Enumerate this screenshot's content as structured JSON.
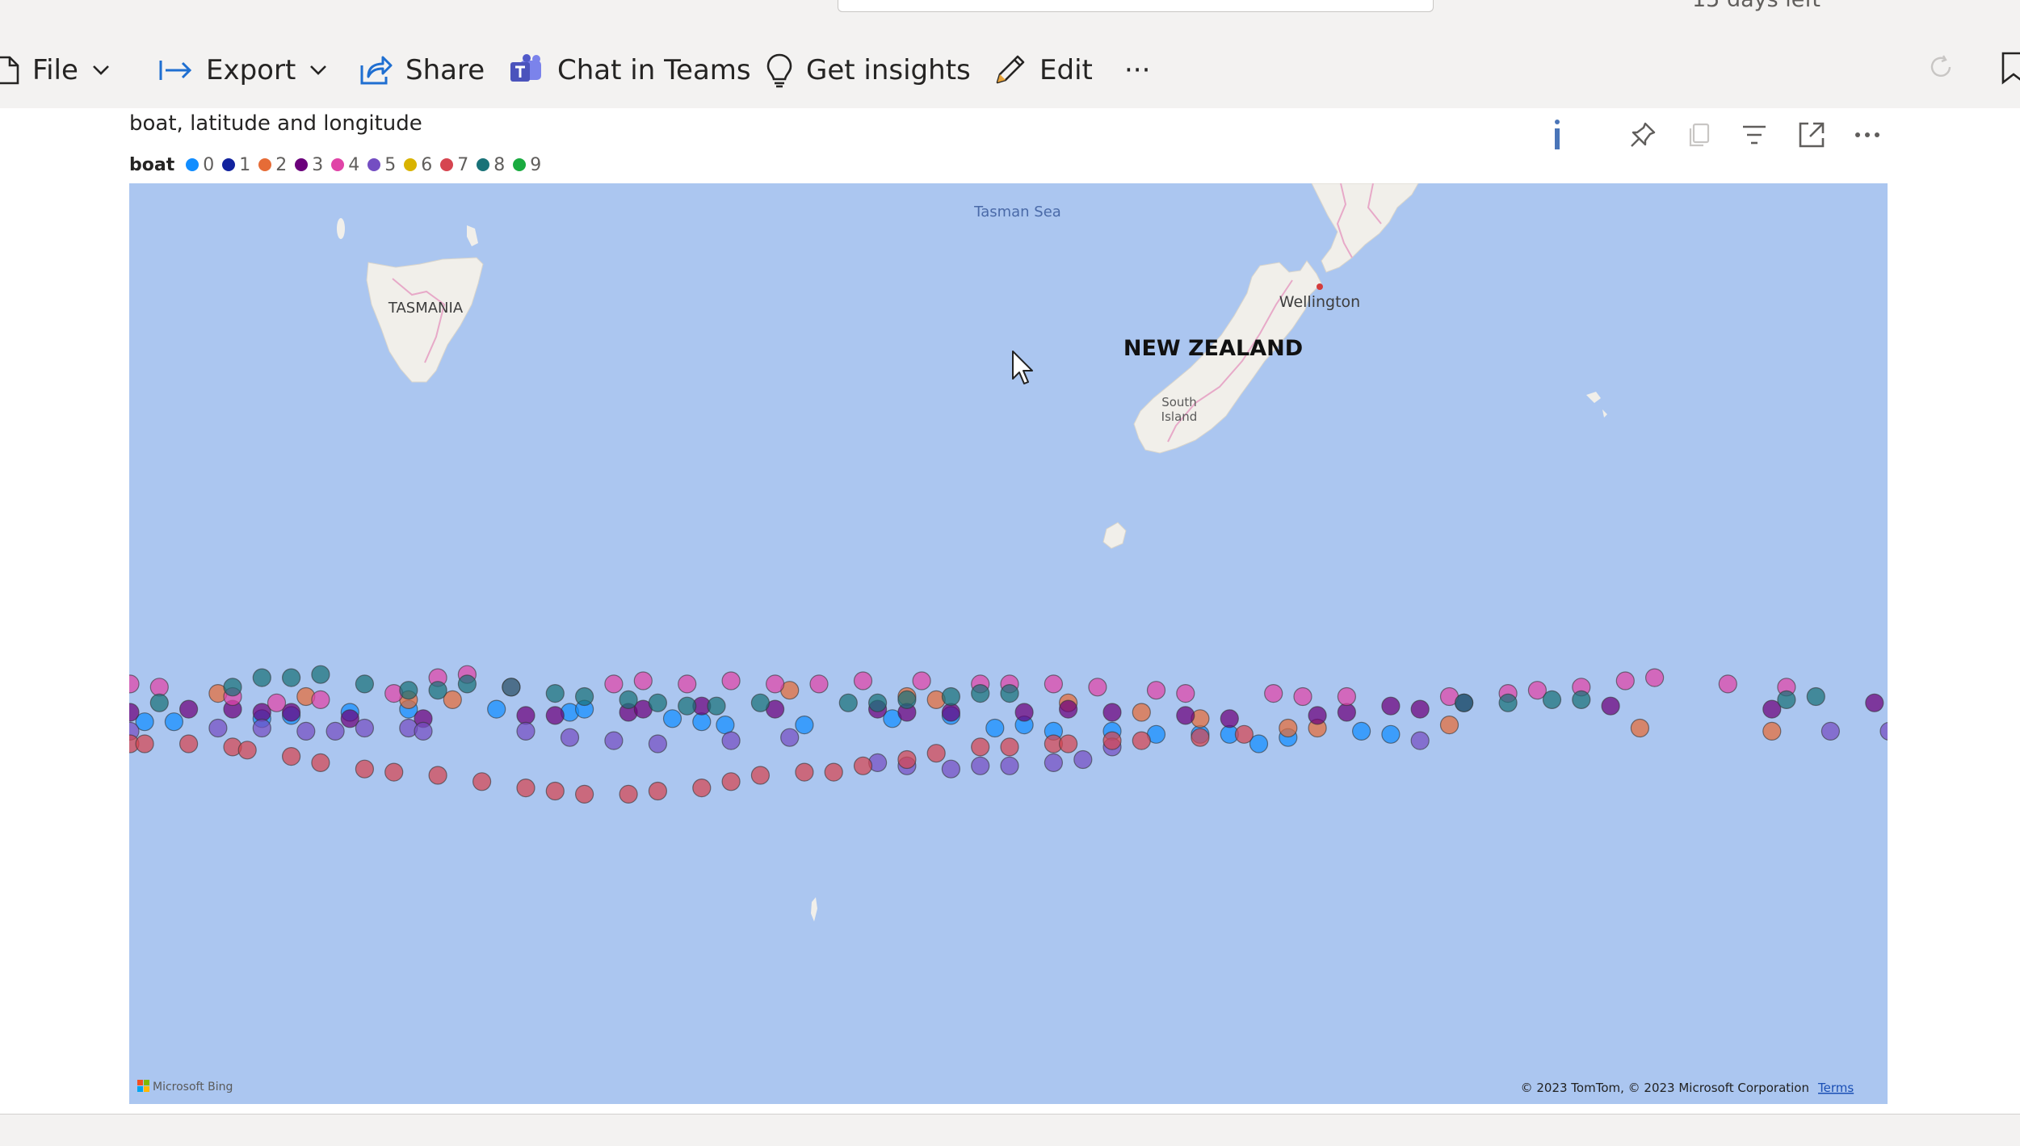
{
  "header": {
    "trial_text": "15 days left"
  },
  "toolbar": {
    "file_label": "File",
    "export_label": "Export",
    "share_label": "Share",
    "chat_label": "Chat in Teams",
    "insights_label": "Get insights",
    "edit_label": "Edit",
    "more_label": "···"
  },
  "visual": {
    "title": "boat, latitude and longitude",
    "legend_title": "boat",
    "legend": [
      {
        "label": "0",
        "color": "#118dff"
      },
      {
        "label": "1",
        "color": "#12239e"
      },
      {
        "label": "2",
        "color": "#e66c37"
      },
      {
        "label": "3",
        "color": "#6b007b"
      },
      {
        "label": "4",
        "color": "#e044a7"
      },
      {
        "label": "5",
        "color": "#744ec2"
      },
      {
        "label": "6",
        "color": "#d9b300"
      },
      {
        "label": "7",
        "color": "#d64550"
      },
      {
        "label": "8",
        "color": "#197278"
      },
      {
        "label": "9",
        "color": "#1aab40"
      }
    ],
    "header_icons": [
      "info-icon",
      "pin-icon",
      "copy-icon",
      "filter-icon",
      "focus-mode-icon",
      "more-options-icon"
    ]
  },
  "map": {
    "labels": {
      "sea": "Tasman Sea",
      "tasmania": "TASMANIA",
      "country": "NEW ZEALAND",
      "city": "Wellington",
      "island": "South\nIsland"
    },
    "attribution": "© 2023 TomTom, © 2023 Microsoft Corporation",
    "terms": "Terms",
    "provider": "Microsoft Bing",
    "water_color": "#abc6f0",
    "land_color": "#f1efea"
  },
  "chart_data": {
    "type": "scatter",
    "title": "boat, latitude and longitude",
    "legend_title": "boat",
    "legend_placement": "top-left",
    "series": [
      {
        "name": "0",
        "points": [
          [
            167.5,
            -55.7
          ],
          [
            168.5,
            -55.7
          ],
          [
            171.5,
            -55.6
          ],
          [
            172.5,
            -55.5
          ],
          [
            174.5,
            -55.4
          ],
          [
            176.5,
            -55.3
          ],
          [
            179.5,
            -55.3
          ],
          [
            182.0,
            -55.4
          ],
          [
            182.5,
            -55.3
          ],
          [
            185.5,
            -55.6
          ],
          [
            186.5,
            -55.7
          ],
          [
            187.3,
            -55.8
          ],
          [
            190.0,
            -55.8
          ],
          [
            193.0,
            -55.6
          ],
          [
            195.0,
            -55.5
          ],
          [
            196.5,
            -55.9
          ],
          [
            197.5,
            -55.8
          ],
          [
            198.5,
            -56.0
          ],
          [
            200.5,
            -56.0
          ],
          [
            202.0,
            -56.1
          ],
          [
            203.5,
            -56.1
          ],
          [
            204.5,
            -56.1
          ],
          [
            205.5,
            -56.4
          ],
          [
            206.5,
            -56.2
          ],
          [
            209.0,
            -56.0
          ],
          [
            210.0,
            -56.1
          ]
        ]
      },
      {
        "name": "2",
        "points": [
          [
            170.0,
            -54.8
          ],
          [
            173.0,
            -54.9
          ],
          [
            176.5,
            -55.0
          ],
          [
            178.0,
            -55.0
          ],
          [
            189.5,
            -54.7
          ],
          [
            193.5,
            -54.9
          ],
          [
            194.5,
            -55.0
          ],
          [
            199.0,
            -55.1
          ],
          [
            201.5,
            -55.4
          ],
          [
            203.5,
            -55.6
          ],
          [
            206.5,
            -55.9
          ],
          [
            207.5,
            -55.9
          ],
          [
            212.0,
            -55.8
          ],
          [
            218.5,
            -55.9
          ],
          [
            223.0,
            -56.0
          ],
          [
            228.5,
            -55.9
          ],
          [
            229.5,
            -55.9
          ],
          [
            234.0,
            -56.2
          ],
          [
            236.0,
            -56.0
          ],
          [
            236.5,
            -55.9
          ],
          [
            239.0,
            -55.7
          ],
          [
            240.5,
            -55.5
          ],
          [
            243.0,
            -55.7
          ],
          [
            244.0,
            -55.6
          ],
          [
            248.0,
            -56.0
          ],
          [
            250.0,
            -56.2
          ],
          [
            251.0,
            -56.3
          ],
          [
            253.5,
            -56.6
          ],
          [
            255.5,
            -56.9
          ],
          [
            256.0,
            -56.9
          ]
        ]
      },
      {
        "name": "3",
        "points": [
          [
            167.0,
            -55.4
          ],
          [
            169.0,
            -55.3
          ],
          [
            170.5,
            -55.3
          ],
          [
            171.5,
            -55.4
          ],
          [
            172.5,
            -55.4
          ],
          [
            174.5,
            -55.6
          ],
          [
            177.0,
            -55.6
          ],
          [
            180.5,
            -55.5
          ],
          [
            181.5,
            -55.5
          ],
          [
            184.0,
            -55.4
          ],
          [
            184.5,
            -55.3
          ],
          [
            186.5,
            -55.2
          ],
          [
            189.0,
            -55.3
          ],
          [
            192.5,
            -55.3
          ],
          [
            193.5,
            -55.4
          ],
          [
            195.0,
            -55.4
          ],
          [
            197.5,
            -55.4
          ],
          [
            199.0,
            -55.3
          ],
          [
            200.5,
            -55.4
          ],
          [
            203.0,
            -55.5
          ],
          [
            204.5,
            -55.6
          ],
          [
            207.5,
            -55.5
          ],
          [
            208.5,
            -55.4
          ],
          [
            210.0,
            -55.2
          ],
          [
            211.0,
            -55.3
          ],
          [
            212.5,
            -55.1
          ],
          [
            217.5,
            -55.2
          ],
          [
            223.0,
            -55.3
          ],
          [
            226.5,
            -55.1
          ],
          [
            232.0,
            -55.0
          ],
          [
            233.5,
            -54.9
          ],
          [
            238.5,
            -54.7
          ]
        ]
      },
      {
        "name": "4",
        "points": [
          [
            167.0,
            -54.5
          ],
          [
            168.0,
            -54.6
          ],
          [
            170.5,
            -54.9
          ],
          [
            172.0,
            -55.1
          ],
          [
            173.5,
            -55.0
          ],
          [
            176.0,
            -54.8
          ],
          [
            177.5,
            -54.3
          ],
          [
            178.5,
            -54.2
          ],
          [
            180.0,
            -54.6
          ],
          [
            183.5,
            -54.5
          ],
          [
            184.5,
            -54.4
          ],
          [
            186.0,
            -54.5
          ],
          [
            187.5,
            -54.4
          ],
          [
            189.0,
            -54.5
          ],
          [
            190.5,
            -54.5
          ],
          [
            192.0,
            -54.4
          ],
          [
            194.0,
            -54.4
          ],
          [
            196.0,
            -54.5
          ],
          [
            197.0,
            -54.5
          ],
          [
            198.5,
            -54.5
          ],
          [
            200.0,
            -54.6
          ],
          [
            202.0,
            -54.7
          ],
          [
            203.0,
            -54.8
          ],
          [
            206.0,
            -54.8
          ],
          [
            207.0,
            -54.9
          ],
          [
            208.5,
            -54.9
          ],
          [
            212.0,
            -54.9
          ],
          [
            214.0,
            -54.8
          ],
          [
            215.0,
            -54.7
          ],
          [
            216.5,
            -54.6
          ],
          [
            218.0,
            -54.4
          ],
          [
            219.0,
            -54.3
          ],
          [
            221.5,
            -54.5
          ],
          [
            223.5,
            -54.6
          ]
        ]
      },
      {
        "name": "5",
        "points": [
          [
            167.0,
            -56.0
          ],
          [
            170.0,
            -55.9
          ],
          [
            171.5,
            -55.9
          ],
          [
            173.0,
            -56.0
          ],
          [
            174.0,
            -56.0
          ],
          [
            175.0,
            -55.9
          ],
          [
            176.5,
            -55.9
          ],
          [
            177.0,
            -56.0
          ],
          [
            180.5,
            -56.0
          ],
          [
            182.0,
            -56.2
          ],
          [
            183.5,
            -56.3
          ],
          [
            185.0,
            -56.4
          ],
          [
            187.5,
            -56.3
          ],
          [
            189.5,
            -56.2
          ],
          [
            192.5,
            -57.0
          ],
          [
            193.5,
            -57.1
          ],
          [
            195.0,
            -57.2
          ],
          [
            196.0,
            -57.1
          ],
          [
            197.0,
            -57.1
          ],
          [
            198.5,
            -57.0
          ],
          [
            199.5,
            -56.9
          ],
          [
            200.5,
            -56.5
          ],
          [
            211.0,
            -56.3
          ],
          [
            225.0,
            -56.0
          ],
          [
            227.0,
            -56.0
          ],
          [
            228.0,
            -56.0
          ],
          [
            229.5,
            -56.0
          ]
        ]
      },
      {
        "name": "7",
        "points": [
          [
            167.0,
            -56.4
          ],
          [
            167.5,
            -56.4
          ],
          [
            169.0,
            -56.4
          ],
          [
            170.5,
            -56.5
          ],
          [
            171.0,
            -56.6
          ],
          [
            172.5,
            -56.8
          ],
          [
            173.5,
            -57.0
          ],
          [
            175.0,
            -57.2
          ],
          [
            176.0,
            -57.3
          ],
          [
            177.5,
            -57.4
          ],
          [
            179.0,
            -57.6
          ],
          [
            180.5,
            -57.8
          ],
          [
            181.5,
            -57.9
          ],
          [
            182.5,
            -58.0
          ],
          [
            184.0,
            -58.0
          ],
          [
            185.0,
            -57.9
          ],
          [
            186.5,
            -57.8
          ],
          [
            187.5,
            -57.6
          ],
          [
            188.5,
            -57.4
          ],
          [
            190.0,
            -57.3
          ],
          [
            191.0,
            -57.3
          ],
          [
            192.0,
            -57.1
          ],
          [
            193.5,
            -56.9
          ],
          [
            194.5,
            -56.7
          ],
          [
            196.0,
            -56.5
          ],
          [
            197.0,
            -56.5
          ],
          [
            198.5,
            -56.4
          ],
          [
            199.0,
            -56.4
          ],
          [
            200.5,
            -56.3
          ],
          [
            201.5,
            -56.3
          ],
          [
            203.5,
            -56.2
          ],
          [
            205.0,
            -56.1
          ]
        ]
      },
      {
        "name": "8",
        "points": [
          [
            166.5,
            -55.2
          ],
          [
            168.0,
            -55.1
          ],
          [
            170.5,
            -54.6
          ],
          [
            171.5,
            -54.3
          ],
          [
            172.5,
            -54.3
          ],
          [
            173.5,
            -54.2
          ],
          [
            175.0,
            -54.5
          ],
          [
            176.5,
            -54.7
          ],
          [
            177.5,
            -54.7
          ],
          [
            178.5,
            -54.5
          ],
          [
            180.0,
            -54.6
          ],
          [
            181.5,
            -54.8
          ],
          [
            182.5,
            -54.9
          ],
          [
            184.0,
            -55.0
          ],
          [
            185.0,
            -55.1
          ],
          [
            186.0,
            -55.2
          ],
          [
            187.0,
            -55.2
          ],
          [
            188.5,
            -55.1
          ],
          [
            191.5,
            -55.1
          ],
          [
            192.5,
            -55.1
          ],
          [
            193.5,
            -55.0
          ],
          [
            195.0,
            -54.9
          ],
          [
            196.0,
            -54.8
          ],
          [
            197.0,
            -54.8
          ],
          [
            212.5,
            -55.1
          ],
          [
            214.0,
            -55.1
          ],
          [
            215.5,
            -55.0
          ],
          [
            216.5,
            -55.0
          ],
          [
            223.5,
            -55.0
          ],
          [
            224.5,
            -54.9
          ]
        ]
      }
    ]
  }
}
